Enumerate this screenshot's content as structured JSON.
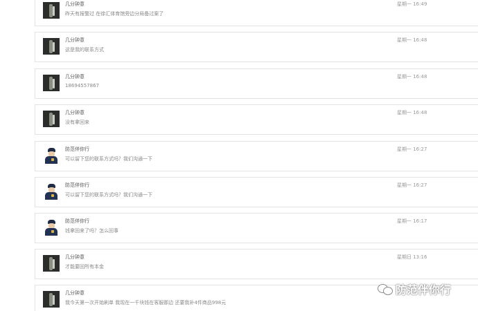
{
  "messages": [
    {
      "name": "几分钟意",
      "text": "昨天有报警过 在徐汇体育馆旁边分局备过案了",
      "time": "星期一 16:49",
      "avatar": "dark-photo-avatar"
    },
    {
      "name": "几分钟意",
      "text": "这是我的联系方式",
      "time": "星期一 16:48",
      "avatar": "dark-photo-avatar"
    },
    {
      "name": "几分钟意",
      "text": "18694557867",
      "time": "星期一 16:48",
      "avatar": "dark-photo-avatar"
    },
    {
      "name": "几分钟意",
      "text": "没有拿回来",
      "time": "星期一 16:48",
      "avatar": "dark-photo-avatar"
    },
    {
      "name": "防范伴你行",
      "text": "可以留下您的联系方式吗？我们沟通一下",
      "time": "星期一 16:27",
      "avatar": "police-avatar"
    },
    {
      "name": "防范伴你行",
      "text": "可以留下您的联系方式吗？我们沟通一下",
      "time": "星期一 16:27",
      "avatar": "police-avatar"
    },
    {
      "name": "防范伴你行",
      "text": "钱拿回来了吗？怎么回事",
      "time": "星期一 16:17",
      "avatar": "police-avatar"
    },
    {
      "name": "几分钟意",
      "text": "才能要回所有本金",
      "time": "星期日 13:16",
      "avatar": "dark-photo-avatar"
    },
    {
      "name": "几分钟意",
      "text": "我今天第一次开始刷单 我现在一千块钱在客服那边 还要我补4件商品998元",
      "time": "",
      "avatar": "dark-photo-avatar"
    }
  ],
  "watermark": {
    "text": "防范伴你行",
    "icon": "wechat-icon"
  }
}
